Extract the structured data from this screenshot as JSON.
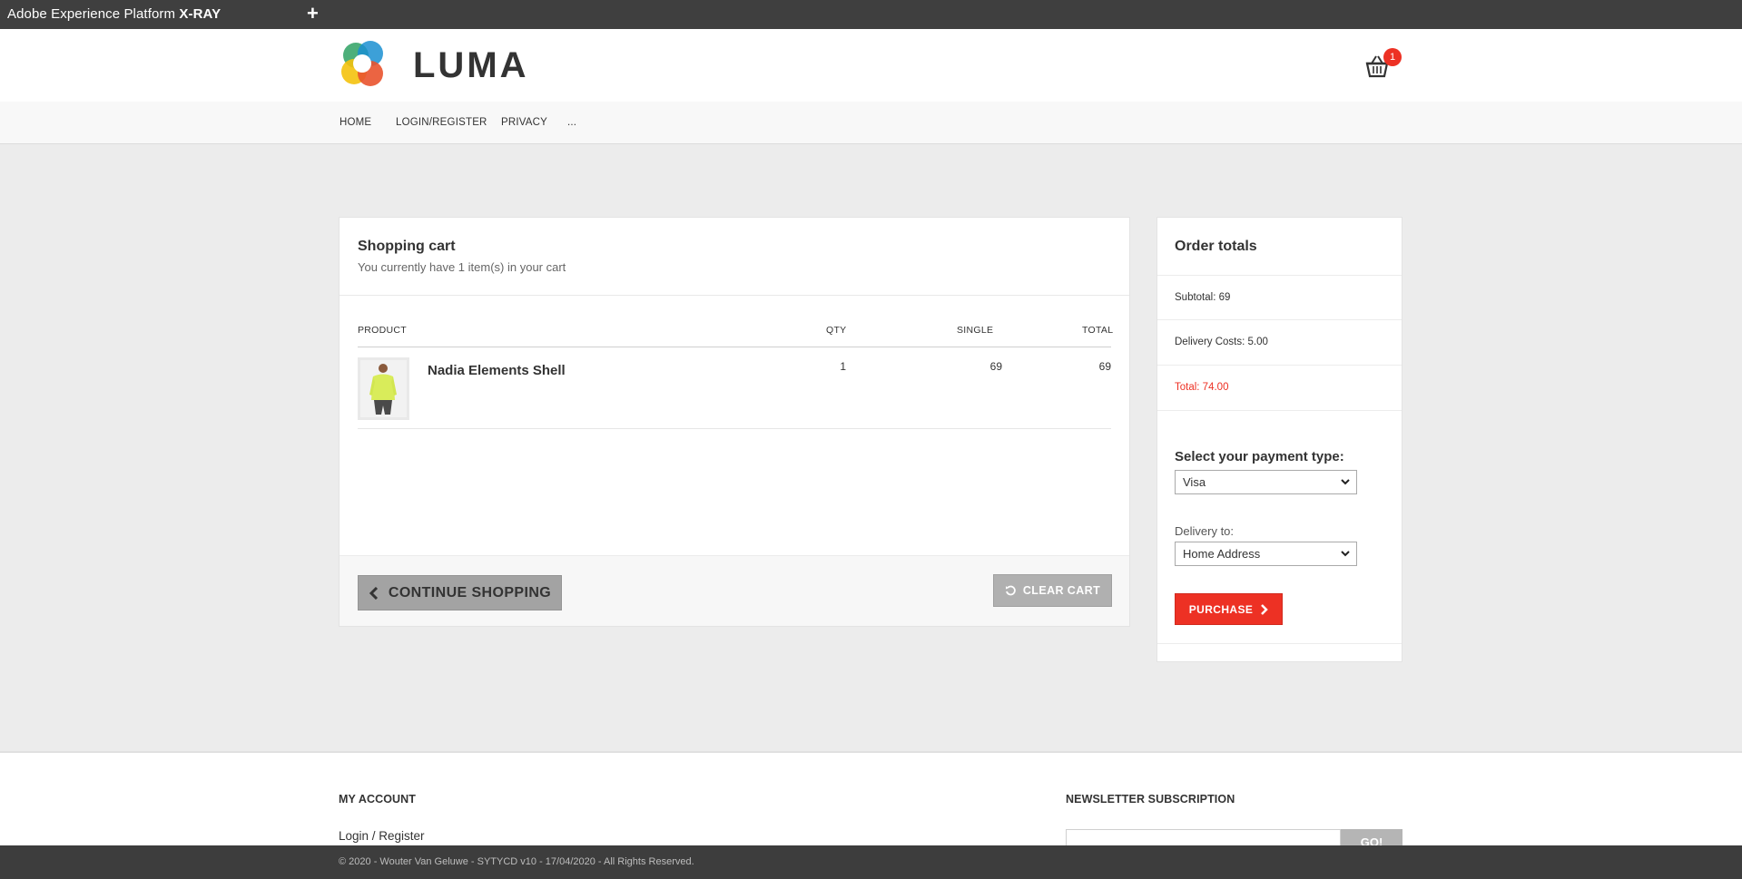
{
  "xray": {
    "title_prefix": "Adobe Experience Platform",
    "title_strong": "X-RAY",
    "new_tab": "+"
  },
  "header": {
    "logo_text": "LUMA",
    "cart_count": "1"
  },
  "nav": {
    "home": "HOME",
    "login": "LOGIN/REGISTER",
    "privacy": "PRIVACY",
    "more": "..."
  },
  "cart": {
    "title": "Shopping cart",
    "subtitle": "You currently have 1 item(s) in your cart",
    "columns": {
      "product": "PRODUCT",
      "qty": "QTY",
      "single": "SINGLE",
      "total": "TOTAL"
    },
    "items": [
      {
        "name": "Nadia Elements Shell",
        "qty": "1",
        "single": "69",
        "total": "69"
      }
    ],
    "continue_label": "CONTINUE SHOPPING",
    "clear_label": "CLEAR CART"
  },
  "totals": {
    "title": "Order totals",
    "subtotal": "Subtotal: 69",
    "delivery_costs": "Delivery Costs: 5.00",
    "total": "Total: 74.00",
    "payment_label": "Select your payment type:",
    "payment_value": "Visa",
    "delivery_label": "Delivery to:",
    "delivery_value": "Home Address",
    "purchase_label": "PURCHASE"
  },
  "footer": {
    "account_heading": "MY ACCOUNT",
    "login_link": "Login / Register",
    "newsletter_heading": "NEWSLETTER SUBSCRIPTION",
    "go_label": "GO!",
    "copyright": "© 2020 - Wouter Van Geluwe - SYTYCD v10 - 17/04/2020 - All Rights Reserved."
  },
  "colors": {
    "accent": "#ed3124",
    "topbar": "#3f3f3f",
    "background": "#ececec"
  }
}
